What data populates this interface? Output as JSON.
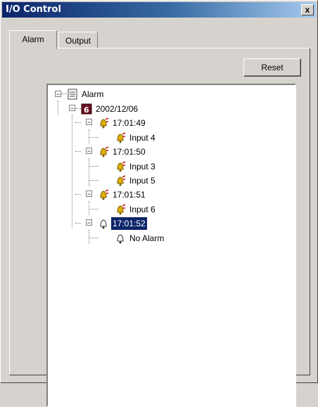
{
  "window": {
    "title": "I/O Control",
    "close_glyph": "x"
  },
  "tabs": [
    {
      "label": "Alarm",
      "active": true
    },
    {
      "label": "Output",
      "active": false
    }
  ],
  "toolbar": {
    "reset_label": "Reset"
  },
  "tree": {
    "root": "Alarm",
    "date": "2002/12/06",
    "times": [
      {
        "time": "17:01:49",
        "inputs": [
          "Input 4"
        ]
      },
      {
        "time": "17:01:50",
        "inputs": [
          "Input 3",
          "Input 5"
        ]
      },
      {
        "time": "17:01:51",
        "inputs": [
          "Input 6"
        ]
      },
      {
        "time": "17:01:52",
        "inputs": [
          "No Alarm"
        ],
        "selected": true
      }
    ]
  },
  "icons": {
    "root": "list-icon",
    "date": "calendar-icon",
    "alarm": "alarm-bell-icon",
    "no_alarm": "bell-icon"
  }
}
